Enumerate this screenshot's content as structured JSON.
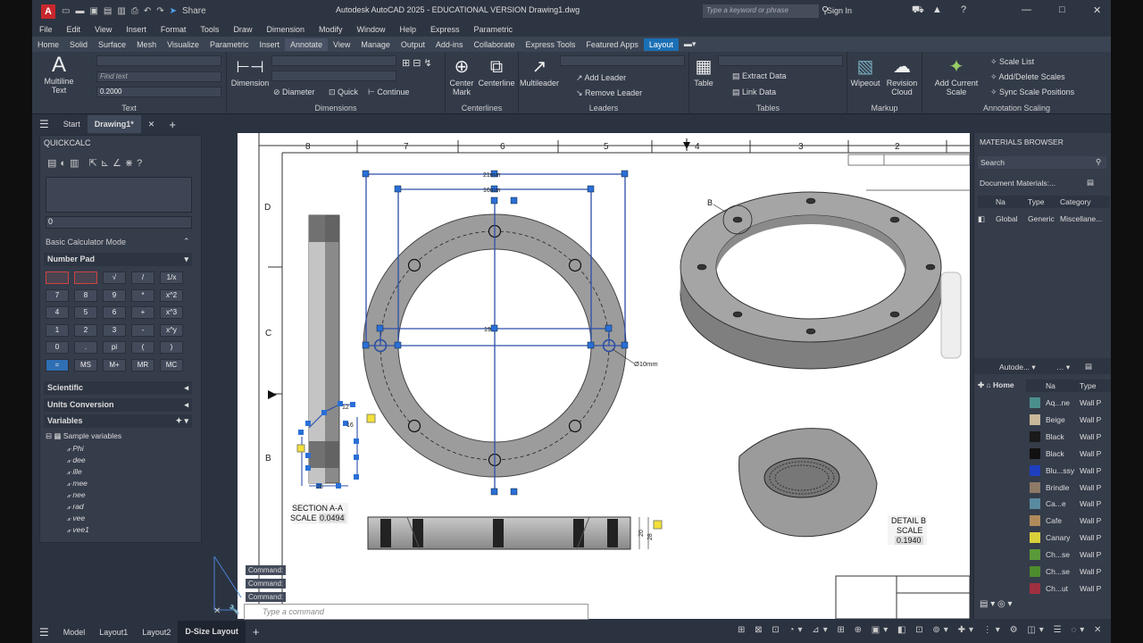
{
  "title_bar": {
    "title": "Autodesk AutoCAD 2025 - EDUCATIONAL VERSION   Drawing1.dwg",
    "search_placeholder": "Type a keyword or phrase",
    "sign_in": "Sign In",
    "share": "Share",
    "app_letter": "A"
  },
  "menu": [
    "File",
    "Edit",
    "View",
    "Insert",
    "Format",
    "Tools",
    "Draw",
    "Dimension",
    "Modify",
    "Window",
    "Help",
    "Express",
    "Parametric"
  ],
  "ribbon_tabs": [
    "Home",
    "Solid",
    "Surface",
    "Mesh",
    "Visualize",
    "Parametric",
    "Insert",
    "Annotate",
    "View",
    "Manage",
    "Output",
    "Add-ins",
    "Collaborate",
    "Express Tools",
    "Featured Apps",
    "Layout"
  ],
  "ribbon": {
    "text": {
      "multiline": "Multiline",
      "text": "Text",
      "find_placeholder": "Find text",
      "height_value": "0.2000",
      "panel": "Text"
    },
    "dimensions": {
      "dimension": "Dimension",
      "diameter": "Diameter",
      "quick": "Quick",
      "continue": "Continue",
      "panel": "Dimensions"
    },
    "centerlines": {
      "center_mark": "Center Mark",
      "centerline": "Centerline",
      "panel": "Centerlines"
    },
    "leaders": {
      "multileader": "Multileader",
      "add_leader": "Add Leader",
      "remove_leader": "Remove Leader",
      "panel": "Leaders"
    },
    "tables": {
      "table": "Table",
      "extract_data": "Extract Data",
      "link_data": "Link Data",
      "panel": "Tables"
    },
    "markup": {
      "wipeout": "Wipeout",
      "revision_cloud": "Revision Cloud",
      "panel": "Markup"
    },
    "annotation_scaling": {
      "add_current_scale": "Add Current Scale",
      "scale_list": "Scale List",
      "add_delete_scales": "Add/Delete Scales",
      "sync_scale_positions": "Sync Scale Positions",
      "panel": "Annotation Scaling"
    }
  },
  "file_tabs": {
    "start": "Start",
    "drawing": "Drawing1*"
  },
  "quickcalc": {
    "header": "QUICKCALC",
    "input_value": "0",
    "mode": "Basic Calculator Mode",
    "number_pad": "Number Pad",
    "keys": [
      [
        "",
        "",
        "√",
        "/",
        "1/x"
      ],
      [
        "7",
        "8",
        "9",
        "*",
        "x^2"
      ],
      [
        "4",
        "5",
        "6",
        "+",
        "x^3"
      ],
      [
        "1",
        "2",
        "3",
        "-",
        "x^y"
      ],
      [
        "0",
        ".",
        "pi",
        "(",
        ")"
      ],
      [
        "=",
        "MS",
        "M+",
        "MR",
        "MC"
      ]
    ],
    "scientific": "Scientific",
    "units_conversion": "Units Conversion",
    "variables": "Variables",
    "sample_variables": "Sample variables",
    "variable_list": [
      "Phi",
      "dee",
      "ille",
      "mee",
      "nee",
      "rad",
      "vee",
      "vee1"
    ]
  },
  "drawing": {
    "ruler_numbers": [
      "8",
      "7",
      "6",
      "5",
      "4",
      "3",
      "2"
    ],
    "row_letters": [
      "D",
      "C",
      "B"
    ],
    "dim_21": "21mm",
    "dim_16": "16mm",
    "dim_19": "19",
    "hole_dim": "Ø10mm",
    "section_title": "SECTION A-A",
    "section_scale_label": "SCALE",
    "section_scale_value": "0.0494",
    "detail_label": "B",
    "detail_title": "DETAIL B",
    "detail_scale_label": "SCALE",
    "detail_scale_value": "0.1940",
    "side_dim_20": "20",
    "side_dim_28": "28",
    "section_dim_12": "12",
    "section_dim_16": "16",
    "section_dim_26": "26"
  },
  "command": {
    "history": [
      "Command:",
      "Command:",
      "Command:"
    ],
    "placeholder": "Type a command"
  },
  "materials_browser": {
    "header": "MATERIALS BROWSER",
    "search": "Search",
    "document_materials": "Document Materials:...",
    "columns": [
      "Na",
      "Type",
      "Category"
    ],
    "row": {
      "name": "Global",
      "type": "Generic",
      "category": "Miscellane..."
    },
    "library_dropdown": "Autode...",
    "home": "Home",
    "lib_columns": [
      "Na",
      "Type"
    ],
    "library_items": [
      {
        "name": "Aq...ne",
        "type": "Wall P",
        "color": "#4b8f8c"
      },
      {
        "name": "Beige",
        "type": "Wall P",
        "color": "#c9b99a"
      },
      {
        "name": "Black",
        "type": "Wall P",
        "color": "#1a1a1a"
      },
      {
        "name": "Black",
        "type": "Wall P",
        "color": "#111111"
      },
      {
        "name": "Blu...ssy",
        "type": "Wall P",
        "color": "#1d3fbf"
      },
      {
        "name": "Brindle",
        "type": "Wall P",
        "color": "#8e7a66"
      },
      {
        "name": "Ca...e",
        "type": "Wall P",
        "color": "#5a8aa0"
      },
      {
        "name": "Cafe",
        "type": "Wall P",
        "color": "#b08a5c"
      },
      {
        "name": "Canary",
        "type": "Wall P",
        "color": "#d8d03a"
      },
      {
        "name": "Ch...se",
        "type": "Wall P",
        "color": "#5a9a3a"
      },
      {
        "name": "Ch...se",
        "type": "Wall P",
        "color": "#4e8b2e"
      },
      {
        "name": "Ch...ut",
        "type": "Wall P",
        "color": "#a03040"
      }
    ]
  },
  "layout_tabs": {
    "model": "Model",
    "layout1": "Layout1",
    "layout2": "Layout2",
    "dsize": "D-Size Layout"
  }
}
